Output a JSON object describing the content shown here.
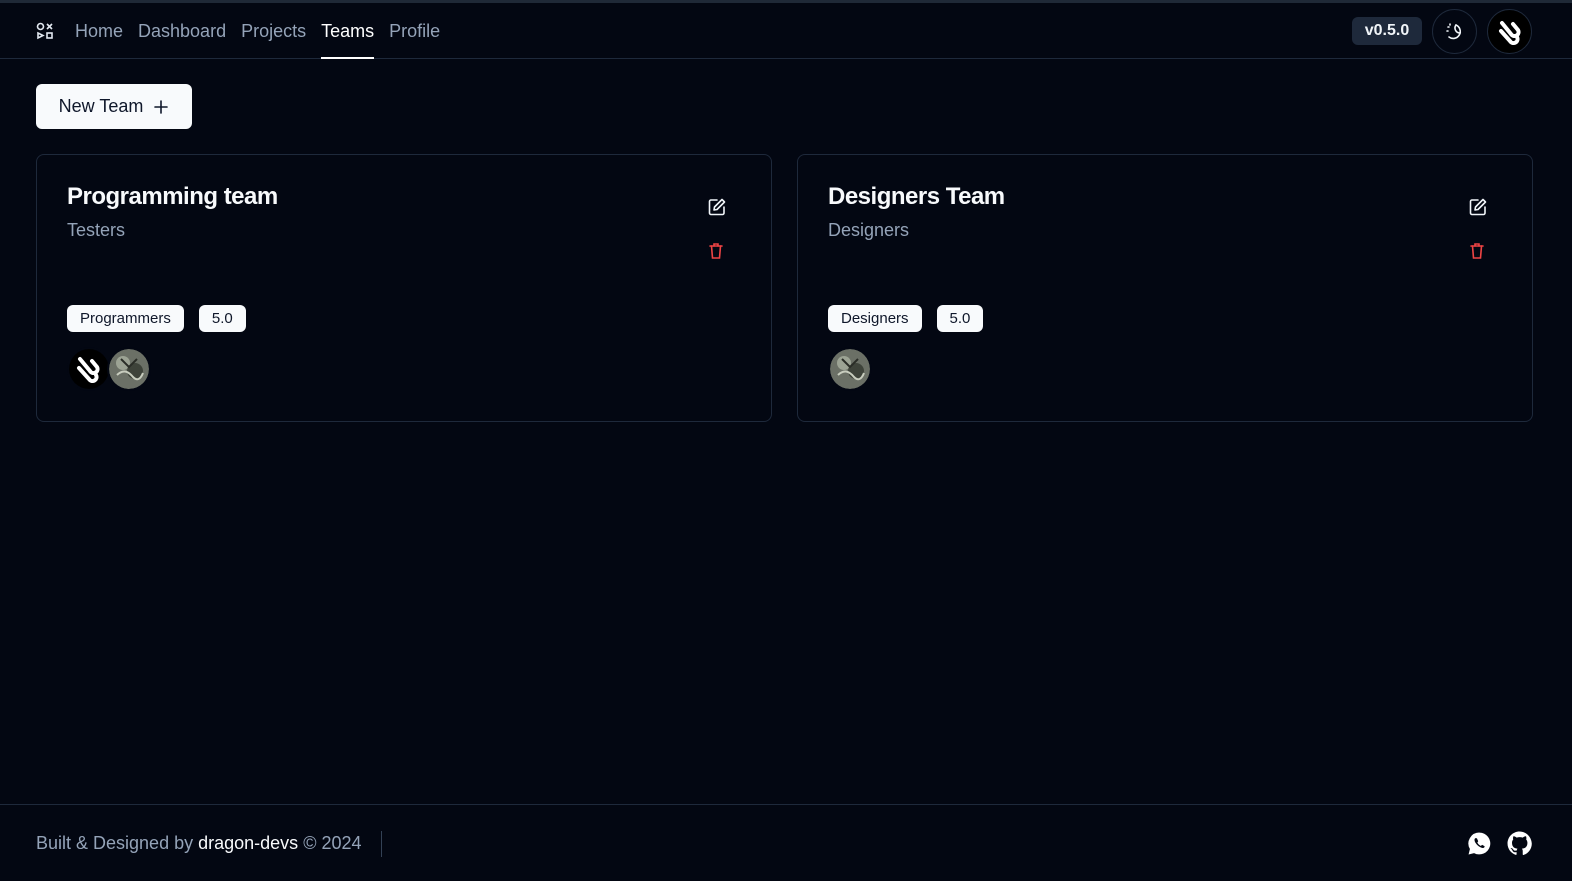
{
  "header": {
    "logo_icon": "app-logo-icon",
    "nav": [
      {
        "label": "Home",
        "active": false
      },
      {
        "label": "Dashboard",
        "active": false
      },
      {
        "label": "Projects",
        "active": false
      },
      {
        "label": "Teams",
        "active": true
      },
      {
        "label": "Profile",
        "active": false
      }
    ],
    "version": "v0.5.0",
    "theme_icon": "moon-sun-icon",
    "user_avatar": "dragon-devs-avatar"
  },
  "toolbar": {
    "new_team_label": "New Team",
    "new_team_icon": "plus-icon"
  },
  "teams": [
    {
      "title": "Programming team",
      "subtitle": "Testers",
      "badges": [
        "Programmers",
        "5.0"
      ],
      "members": [
        "dragon-devs-avatar",
        "dragon-image-avatar"
      ]
    },
    {
      "title": "Designers Team",
      "subtitle": "Designers",
      "badges": [
        "Designers",
        "5.0"
      ],
      "members": [
        "dragon-image-avatar"
      ]
    }
  ],
  "colors": {
    "background": "#030712",
    "border": "#1e293b",
    "muted_text": "#94a3b8",
    "delete_red": "#ef4444"
  },
  "footer": {
    "prefix": "Built & Designed by",
    "author": "dragon-devs",
    "suffix": "© 2024",
    "icons": [
      "whatsapp-icon",
      "github-icon"
    ]
  }
}
